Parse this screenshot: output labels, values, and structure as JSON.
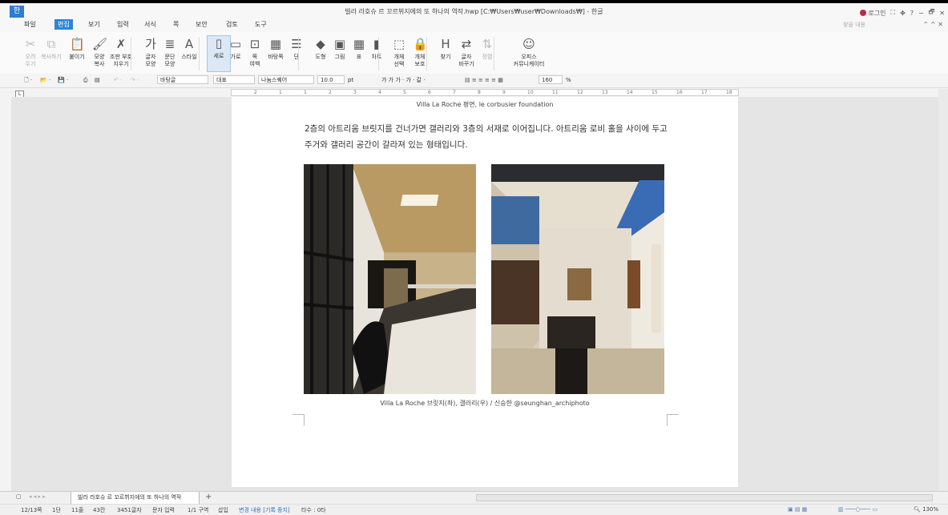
{
  "window": {
    "title": "빌라 라호슈 르 꼬르뷔지에의 또 하나의 역작.hwp [C:₩Users₩user₩Downloads₩] - 한글",
    "app_icon": "한",
    "login_label": "로그인",
    "controls": [
      "⛶",
      "✥",
      "?",
      "−",
      "🗗",
      "✕"
    ]
  },
  "menu": {
    "items": [
      "파일",
      "편집",
      "보기",
      "입력",
      "서식",
      "쪽",
      "보안",
      "검토",
      "도구"
    ],
    "active": "편집",
    "search_placeholder": "찾을 내용",
    "right_icons": "⌃ ^ ✕"
  },
  "ribbon": {
    "buttons": [
      {
        "label": "오려\n두기",
        "icon": "scissors-icon",
        "glyph": "✂",
        "disabled": true
      },
      {
        "label": "복사하기",
        "icon": "copy-icon",
        "glyph": "⧉",
        "disabled": true
      },
      {
        "label": "붙이기",
        "icon": "paste-icon",
        "glyph": "📋",
        "disabled": false
      },
      {
        "label": "모양\n복사",
        "icon": "format-painter-icon",
        "glyph": "🖌",
        "disabled": false
      },
      {
        "label": "조판 부호\n지우기",
        "icon": "clear-marks-icon",
        "glyph": "✗",
        "disabled": false
      },
      {
        "label": "글자\n모양",
        "icon": "char-shape-icon",
        "glyph": "가",
        "disabled": false
      },
      {
        "label": "문단\n모양",
        "icon": "para-shape-icon",
        "glyph": "≣",
        "disabled": false
      },
      {
        "label": "스타일",
        "icon": "style-icon",
        "glyph": "A",
        "disabled": false
      },
      {
        "label": "세로",
        "icon": "portrait-icon",
        "glyph": "▯",
        "disabled": false,
        "selected": true
      },
      {
        "label": "가로",
        "icon": "landscape-icon",
        "glyph": "▭",
        "disabled": false
      },
      {
        "label": "쪽\n여백",
        "icon": "margin-icon",
        "glyph": "⊡",
        "disabled": false
      },
      {
        "label": "바탕쪽",
        "icon": "master-page-icon",
        "glyph": "▦",
        "disabled": false
      },
      {
        "label": "단",
        "icon": "columns-icon",
        "glyph": "☰",
        "disabled": false
      },
      {
        "label": "도형",
        "icon": "shape-icon",
        "glyph": "◆",
        "disabled": false
      },
      {
        "label": "그림",
        "icon": "picture-icon",
        "glyph": "▣",
        "disabled": false
      },
      {
        "label": "표",
        "icon": "table-icon",
        "glyph": "▦",
        "disabled": false
      },
      {
        "label": "차트",
        "icon": "chart-icon",
        "glyph": "▮",
        "disabled": false
      },
      {
        "label": "개체\n선택",
        "icon": "select-object-icon",
        "glyph": "⬚",
        "disabled": false
      },
      {
        "label": "개체\n보호",
        "icon": "protect-object-icon",
        "glyph": "🔒",
        "disabled": false
      },
      {
        "label": "찾기",
        "icon": "find-icon",
        "glyph": "H",
        "disabled": false
      },
      {
        "label": "글자\n바꾸기",
        "icon": "replace-icon",
        "glyph": "⇄",
        "disabled": false
      },
      {
        "label": "정렬",
        "icon": "sort-icon",
        "glyph": "⇅",
        "disabled": true
      },
      {
        "label": "오피스\n커뮤니케이터",
        "icon": "communicator-icon",
        "glyph": "☺",
        "disabled": false
      }
    ]
  },
  "format_bar": {
    "style": "바탕글",
    "lang": "대표",
    "font": "나눔스퀘어",
    "size": "10.0",
    "unit": "pt",
    "char_buttons": "가 가 가 · 가 · 갈 ·",
    "zoom": "160",
    "zoom_unit": "%"
  },
  "ruler": {
    "numbers": [
      "2",
      "1",
      "1",
      "2",
      "3",
      "4",
      "5",
      "6",
      "7",
      "8",
      "9",
      "10",
      "11",
      "12",
      "13",
      "14",
      "15",
      "16",
      "17",
      "18"
    ]
  },
  "document": {
    "caption_top": "Villa La Roche 평면, le corbusier foundation",
    "paragraph": "2층의 아트리움 브릿지를 건너가면 갤러리와 3층의 서재로 이어집니다. 아트리움 로비 홀을 사이에 두고 주거와 갤러리 공간이 갈라져 있는 형태입니다.",
    "caption_bottom": "Villa La Roche 브릿지(좌), 갤러리(우) / 신승한 @seunghan_archiphoto"
  },
  "tabs": {
    "doc_tab": "빌라 라호슈 르 꼬르뷔지에의 또 하나의 역작",
    "add": "+"
  },
  "status": {
    "page": "12/13쪽",
    "section": "1단",
    "line": "11줄",
    "col": "43칸",
    "chars": "3451글자",
    "mode": "문자 입력",
    "zone": "1/1 구역",
    "insert": "삽입",
    "track": "변경 내용 [기록 중지]",
    "typing": "타수 : 0타",
    "zoom": "130%"
  }
}
